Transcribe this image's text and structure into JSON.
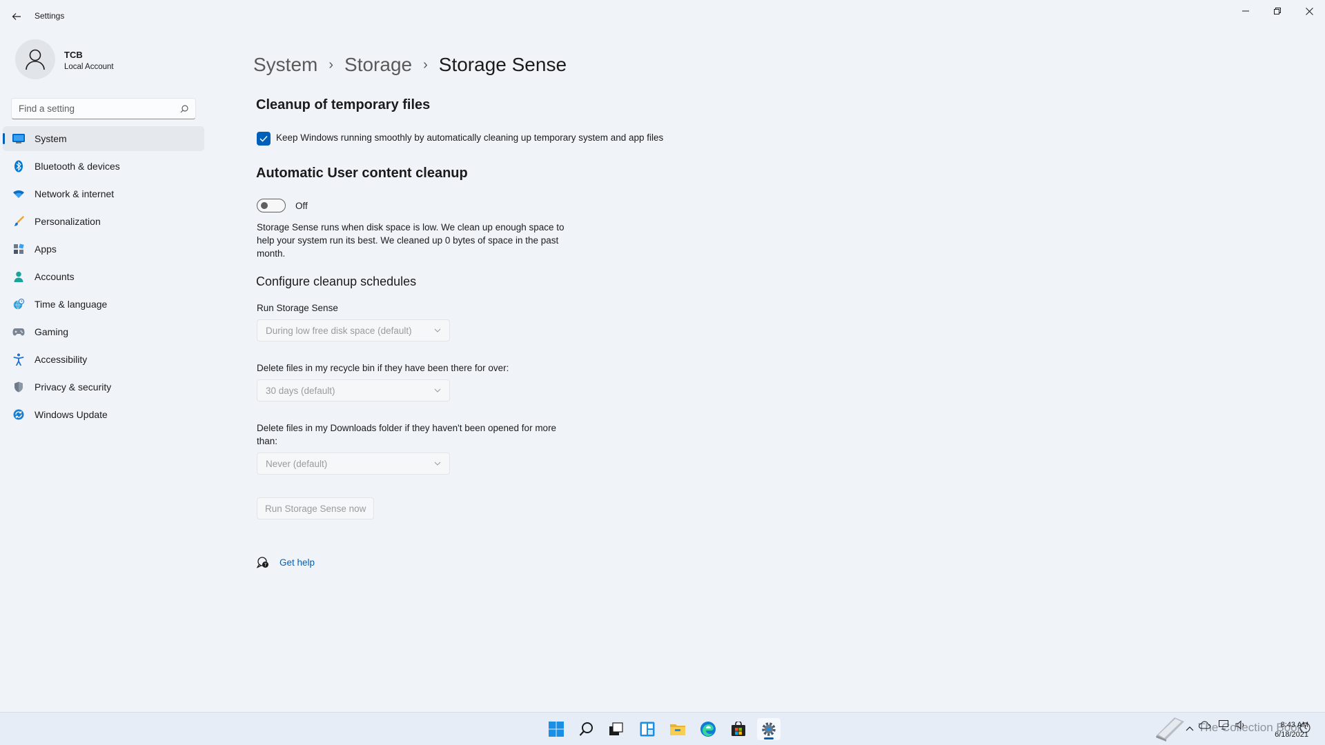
{
  "window": {
    "title": "Settings",
    "back_icon": "back-arrow-icon",
    "controls": [
      "minimize-icon",
      "restore-icon",
      "close-icon"
    ]
  },
  "user": {
    "name": "TCB",
    "account_type": "Local Account",
    "avatar_icon": "person-icon"
  },
  "search": {
    "placeholder": "Find a setting",
    "icon": "search-icon"
  },
  "nav": {
    "items": [
      {
        "label": "System",
        "icon": "monitor-icon",
        "active": true
      },
      {
        "label": "Bluetooth & devices",
        "icon": "bluetooth-icon"
      },
      {
        "label": "Network & internet",
        "icon": "wifi-icon"
      },
      {
        "label": "Personalization",
        "icon": "brush-icon"
      },
      {
        "label": "Apps",
        "icon": "apps-icon"
      },
      {
        "label": "Accounts",
        "icon": "account-icon"
      },
      {
        "label": "Time & language",
        "icon": "globe-clock-icon"
      },
      {
        "label": "Gaming",
        "icon": "gamepad-icon"
      },
      {
        "label": "Accessibility",
        "icon": "accessibility-icon"
      },
      {
        "label": "Privacy & security",
        "icon": "shield-icon"
      },
      {
        "label": "Windows Update",
        "icon": "update-icon"
      }
    ]
  },
  "breadcrumb": {
    "items": [
      "System",
      "Storage"
    ],
    "current": "Storage Sense",
    "separator": "›"
  },
  "cleanup_temp": {
    "heading": "Cleanup of temporary files",
    "checkbox_label": "Keep Windows running smoothly by automatically cleaning up temporary system and app files",
    "checked": true
  },
  "auto_cleanup": {
    "heading": "Automatic User content cleanup",
    "toggle_state": "Off",
    "description": "Storage Sense runs when disk space is low. We clean up enough space to help your system run its best. We cleaned up 0 bytes of space in the past month."
  },
  "schedules": {
    "heading": "Configure cleanup schedules",
    "run_label": "Run Storage Sense",
    "run_value": "During low free disk space (default)",
    "recycle_label": "Delete files in my recycle bin if they have been there for over:",
    "recycle_value": "30 days (default)",
    "downloads_label": "Delete files in my Downloads folder if they haven't been opened for more than:",
    "downloads_value": "Never (default)",
    "run_now_label": "Run Storage Sense now"
  },
  "help": {
    "label": "Get help",
    "icon": "help-chat-icon"
  },
  "taskbar": {
    "icons": [
      "start-icon",
      "search-icon",
      "task-view-icon",
      "widgets-icon",
      "file-explorer-icon",
      "edge-icon",
      "store-icon",
      "settings-icon"
    ],
    "active": "settings-icon",
    "watermark": "The Collection Book",
    "time": "8:43 AM",
    "date": "6/18/2021"
  },
  "colors": {
    "accent": "#005fb8",
    "background": "#f0f4f9",
    "taskbar": "#e7edf6"
  }
}
